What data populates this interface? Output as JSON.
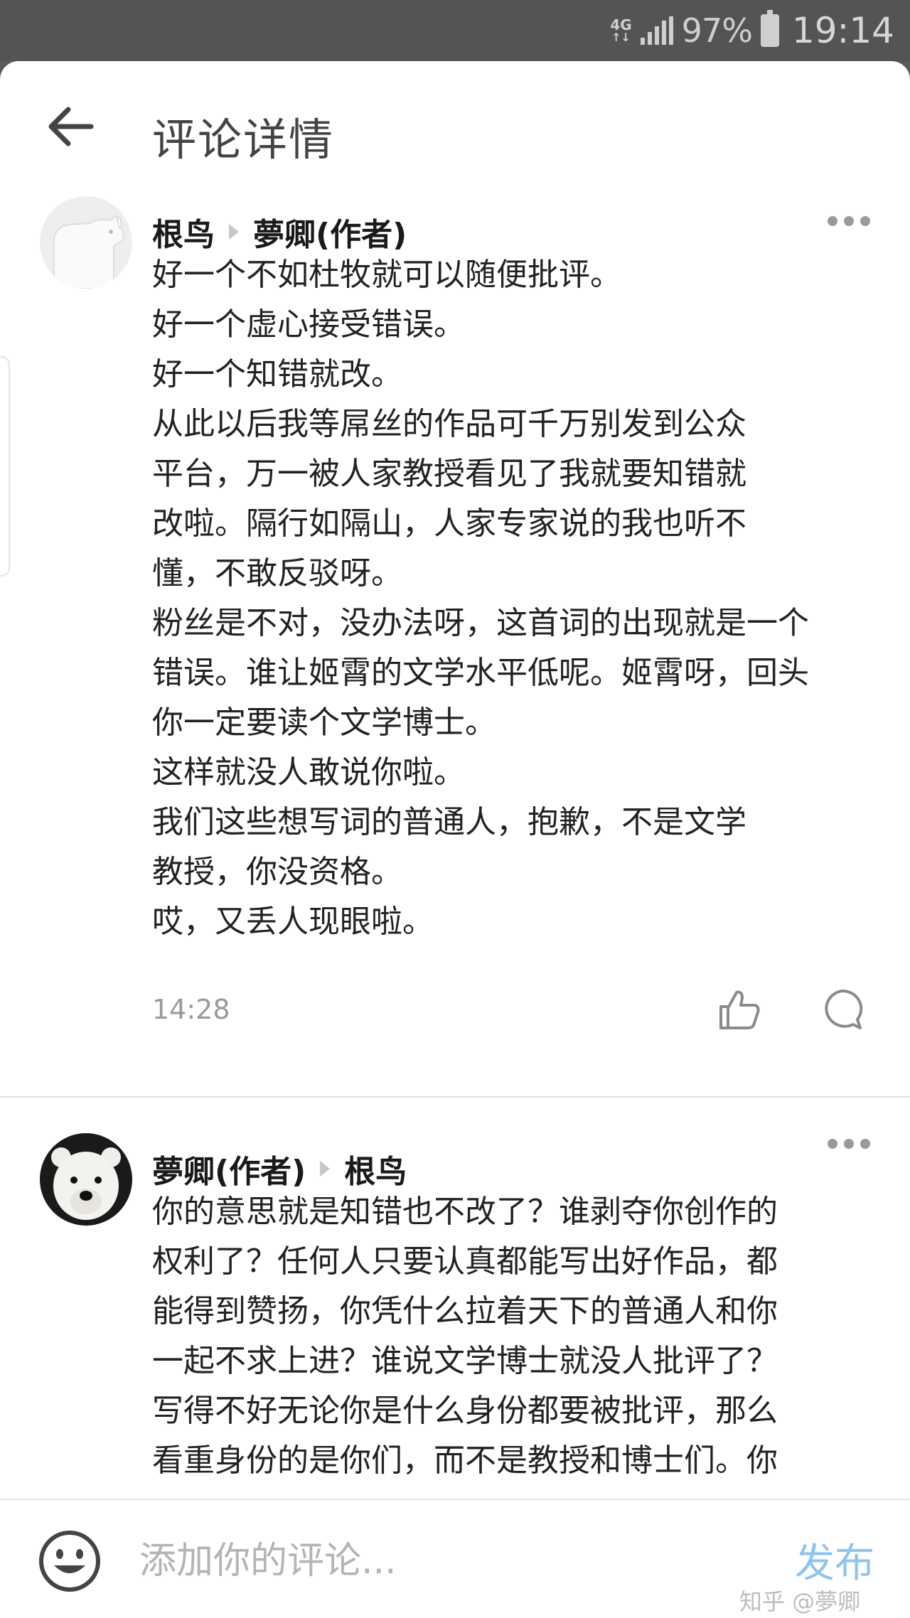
{
  "status_bar": {
    "network": "4G",
    "network_arrows": "↑↓",
    "battery_percent": "97%",
    "time": "19:14"
  },
  "header": {
    "title": "评论详情"
  },
  "comments": [
    {
      "author": "根鸟",
      "reply_to": "夢卿(作者)",
      "lines": [
        "好一个不如杜牧就可以随便批评。",
        "好一个虚心接受错误。",
        "好一个知错就改。",
        "从此以后我等屌丝的作品可千万别发到公众",
        "平台，万一被人家教授看见了我就要知错就",
        "改啦。隔行如隔山，人家专家说的我也听不",
        "懂，不敢反驳呀。",
        "粉丝是不对，没办法呀，这首词的出现就是一个",
        "错误。谁让姬霄的文学水平低呢。姬霄呀，回头",
        "你一定要读个文学博士。",
        "这样就没人敢说你啦。",
        "我们这些想写词的普通人，抱歉，不是文学",
        "教授，你没资格。",
        "哎，又丢人现眼啦。"
      ],
      "time": "14:28"
    },
    {
      "author": "夢卿(作者)",
      "reply_to": "根鸟",
      "lines": [
        "你的意思就是知错也不改了？谁剥夺你创作的",
        "权利了？任何人只要认真都能写出好作品，都",
        "能得到赞扬，你凭什么拉着天下的普通人和你",
        "一起不求上进？谁说文学博士就没人批评了？",
        "写得不好无论你是什么身份都要被批评，那么",
        "看重身份的是你们，而不是教授和博士们。你"
      ]
    }
  ],
  "bottom_bar": {
    "placeholder": "添加你的评论...",
    "publish_label": "发布",
    "watermark": "知乎 @夢卿"
  },
  "colors": {
    "accent": "#8fc4ef",
    "status_bar_bg": "#545454",
    "meta_gray": "#9a9a9a"
  },
  "icons": [
    "back-arrow-icon",
    "more-icon",
    "like-icon",
    "reply-icon",
    "emoji-icon",
    "dog-avatar",
    "polar-bear-avatar"
  ]
}
